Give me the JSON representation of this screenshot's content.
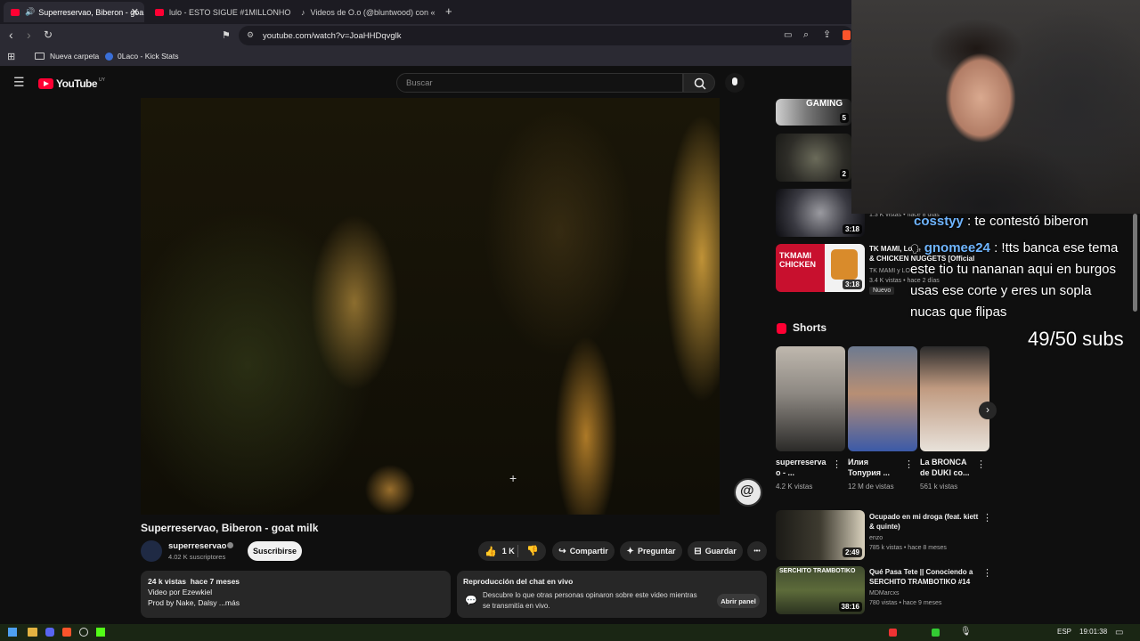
{
  "browser": {
    "tabs": [
      {
        "title": "Superreservao, Biberon - goa",
        "active": true
      },
      {
        "title": "lulo - ESTO SIGUE #1MILLONHOOD",
        "active": false
      },
      {
        "title": "Videos de O.o (@bluntwood) con «",
        "active": false
      }
    ],
    "new_tab": "+",
    "url": "youtube.com/watch?v=JoaHHDqvglk",
    "bookmarks": [
      "Nueva carpeta",
      "0Laco - Kick Stats"
    ]
  },
  "youtube": {
    "logo": "YouTube",
    "region": "UY",
    "search_placeholder": "Buscar",
    "video": {
      "title": "Superreservao, Biberon - goat milk",
      "channel": "superreservao",
      "subscribers": "4.02 K suscriptores",
      "subscribe_label": "Suscribirse",
      "likes": "1 K",
      "share_label": "Compartir",
      "ask_label": "Preguntar",
      "save_label": "Guardar",
      "more_label": "•••",
      "description": {
        "stats": "24 k vistas  hace 7 meses",
        "line1": "Video por Ezewkiel",
        "line2": "Prod by Nake, Dalsy ...más"
      },
      "live_chat": {
        "title": "Reproducción del chat en vivo",
        "text1": "Descubre lo que otras personas opinaron sobre este video mientras",
        "text2": "se transmitía en vivo.",
        "button": "Abrir panel"
      }
    },
    "sidebar": {
      "top_videos": [
        {
          "duration": "5",
          "thumb_text": "GAMING"
        },
        {
          "duration": "2"
        },
        {
          "duration": "3:18",
          "meta": "1.3 K vistas • hace 8 días"
        },
        {
          "duration": "3:18",
          "thumb_text": "TKMAMI CHICKEN",
          "title1": "TK MAMI, Lo",
          "title2": "& CHICKEN NUGGETS [Official",
          "channel": "TK MAMI y LO",
          "meta": "3.4 K vistas • hace 2 días",
          "badge": "Nuevo"
        }
      ],
      "shorts_title": "Shorts",
      "shorts": [
        {
          "title1": "superreserva",
          "title2": "o - ...",
          "views": "4.2 K vistas"
        },
        {
          "title1": "Илия",
          "title2": "Топурия ...",
          "views": "12 M de vistas"
        },
        {
          "title1": "La BRONCA",
          "title2": "de DUKI co...",
          "views": "561 k vistas"
        }
      ],
      "bottom_videos": [
        {
          "duration": "2:49",
          "title1": "Ocupado en mi droga (feat. kiett",
          "title2": "& quinte)",
          "channel": "enzo",
          "meta": "785 k vistas • hace 8 meses"
        },
        {
          "duration": "38:16",
          "thumb_text": "SERCHITO TRAMBOTIKO",
          "title1": "Qué Pasa Tete || Conociendo a",
          "title2": "SERCHITO TRAMBOTIKO #14",
          "channel": "MDMarcxs",
          "meta": "780 vistas • hace 9 meses"
        }
      ]
    }
  },
  "overlay": {
    "chat": [
      {
        "user": "cosstyy",
        "text": " : te contestó biberon"
      },
      {
        "user": "gnomee24",
        "text": " : !tts banca ese tema"
      }
    ],
    "chat_continuation": [
      "este tio tu nananan aqui en burgos",
      "usas ese corte y eres un sopla",
      "nucas que flipas"
    ],
    "sub_goal": "49/50 subs"
  },
  "taskbar": {
    "lang": "ESP",
    "time": "19:01:38"
  },
  "colors": {
    "yt_bg": "#0f0f0f",
    "yt_red": "#ff0033",
    "chat_name": "#6fb5ff",
    "taskbar": "#1a2614"
  }
}
